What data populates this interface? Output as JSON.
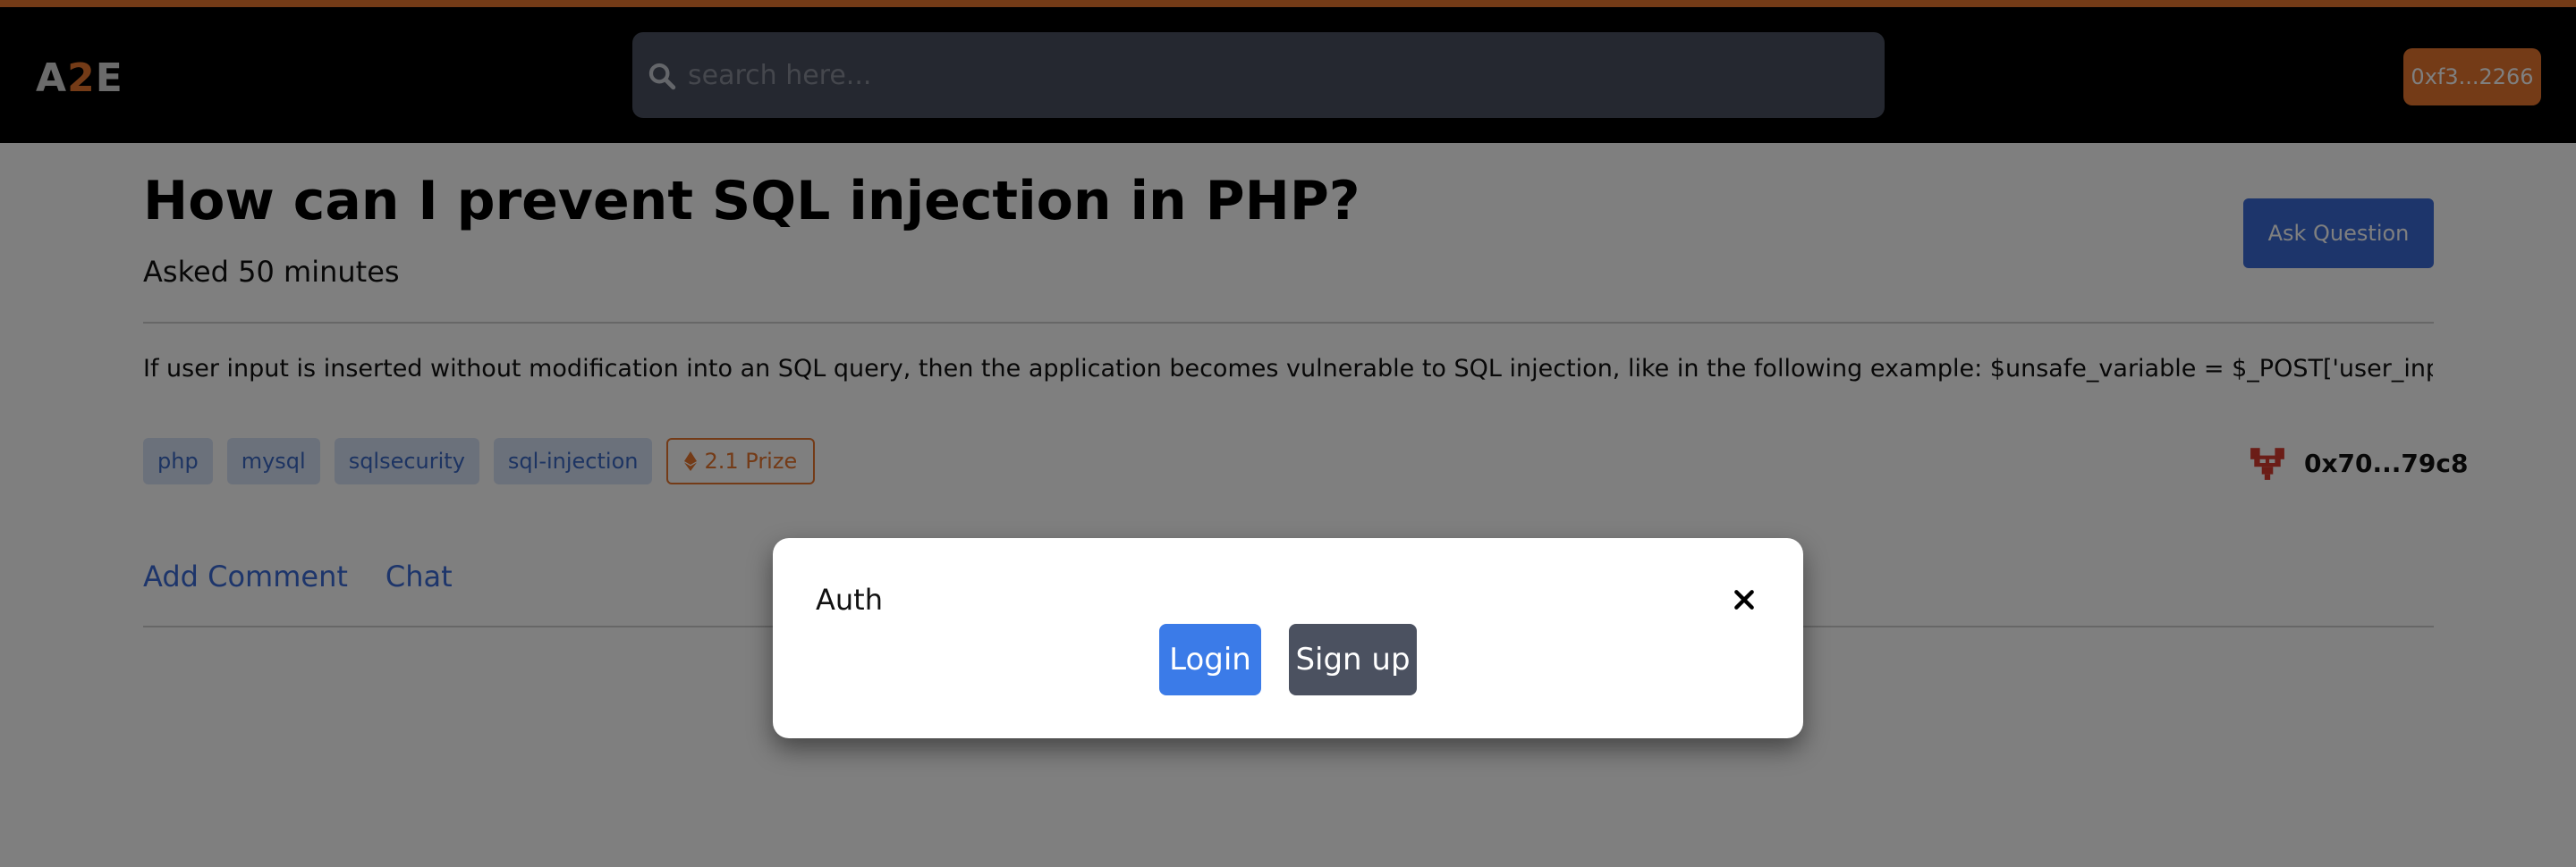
{
  "header": {
    "logo": {
      "part1": "A",
      "part2": "2",
      "part3": "E"
    },
    "search": {
      "placeholder": "search here..."
    },
    "wallet_button": "0xf3...2266"
  },
  "question": {
    "title": "How can I prevent SQL injection in PHP?",
    "asked": "Asked 50 minutes",
    "ask_button": "Ask Question",
    "body": "If user input is inserted without modification into an SQL query, then the application becomes vulnerable to SQL injection, like in the following example: $unsafe_variable = $_POST['user_input']...",
    "tags": [
      "php",
      "mysql",
      "sqlsecurity",
      "sql-injection"
    ],
    "prize": "2.1 Prize",
    "author": "0x70...79c8",
    "actions": {
      "add_comment": "Add Comment",
      "chat": "Chat"
    }
  },
  "modal": {
    "title": "Auth",
    "login": "Login",
    "signup": "Sign up"
  },
  "colors": {
    "accent": "#e8762f",
    "primary": "#3b6bd6",
    "tag_bg": "#d6e2f7",
    "topbar": "#000000"
  }
}
